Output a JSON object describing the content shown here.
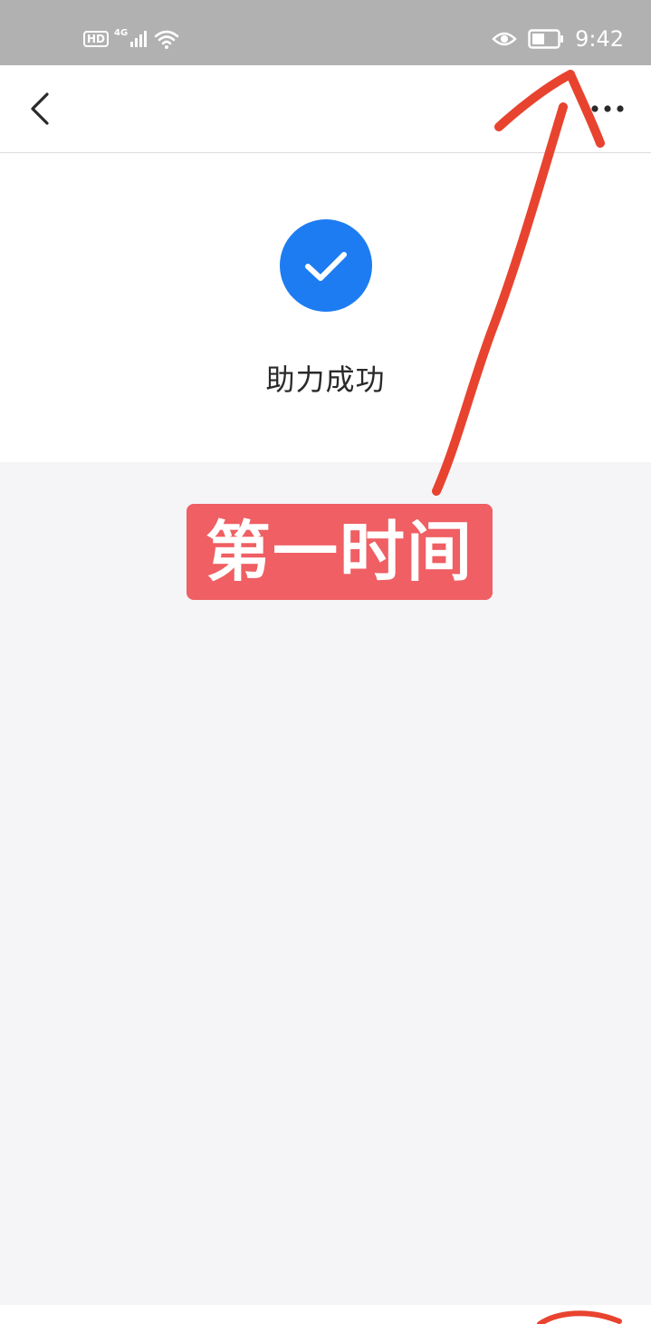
{
  "status_bar": {
    "hd_label": "HD",
    "network_type": "4G",
    "time": "9:42"
  },
  "nav": {
    "back_icon": "chevron-left-icon",
    "more_icon": "more-dots-icon"
  },
  "result": {
    "icon": "check-circle-icon",
    "title": "助力成功"
  },
  "annotation": {
    "label": "第一时间"
  },
  "colors": {
    "status_bar_bg": "#b1b1b1",
    "accent_blue": "#1d7cf2",
    "annotation_red": "#ef5f63",
    "arrow_red": "#e8432f",
    "page_bg": "#f5f4f7"
  }
}
